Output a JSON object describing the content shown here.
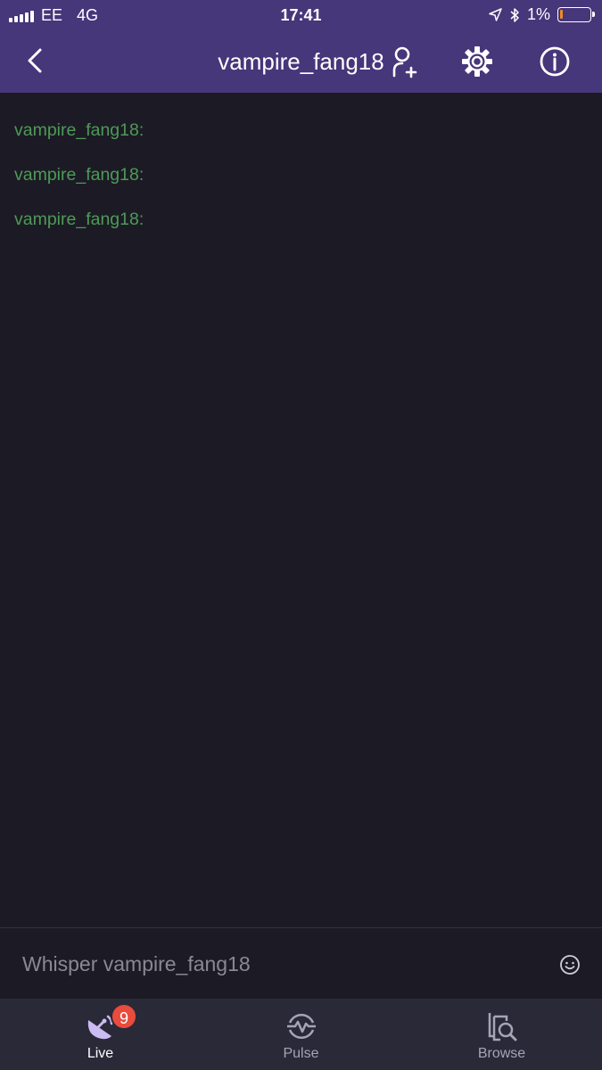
{
  "status_bar": {
    "carrier": "EE",
    "network": "4G",
    "time": "17:41",
    "battery_percent_label": "1%",
    "battery_level": 0.05
  },
  "header": {
    "title": "vampire_fang18",
    "back_icon": "chevron-left-icon",
    "add_friend_icon": "user-plus-icon",
    "settings_icon": "gear-icon",
    "info_icon": "info-icon"
  },
  "messages": [
    {
      "user": "vampire_fang18:",
      "text": ""
    },
    {
      "user": "vampire_fang18:",
      "text": ""
    },
    {
      "user": "vampire_fang18:",
      "text": ""
    }
  ],
  "composer": {
    "placeholder": "Whisper vampire_fang18",
    "value": "",
    "emoji_icon": "smiley-icon"
  },
  "tabs": [
    {
      "label": "Live",
      "icon": "satellite-dish-icon",
      "badge": "9",
      "active": true
    },
    {
      "label": "Pulse",
      "icon": "pulse-icon",
      "active": false
    },
    {
      "label": "Browse",
      "icon": "browse-icon",
      "active": false
    }
  ],
  "colors": {
    "header_bg": "#46367a",
    "chat_bg": "#1c1b25",
    "username": "#4e9a57",
    "tab_bar_bg": "#2a2938",
    "badge": "#e94b3c"
  }
}
